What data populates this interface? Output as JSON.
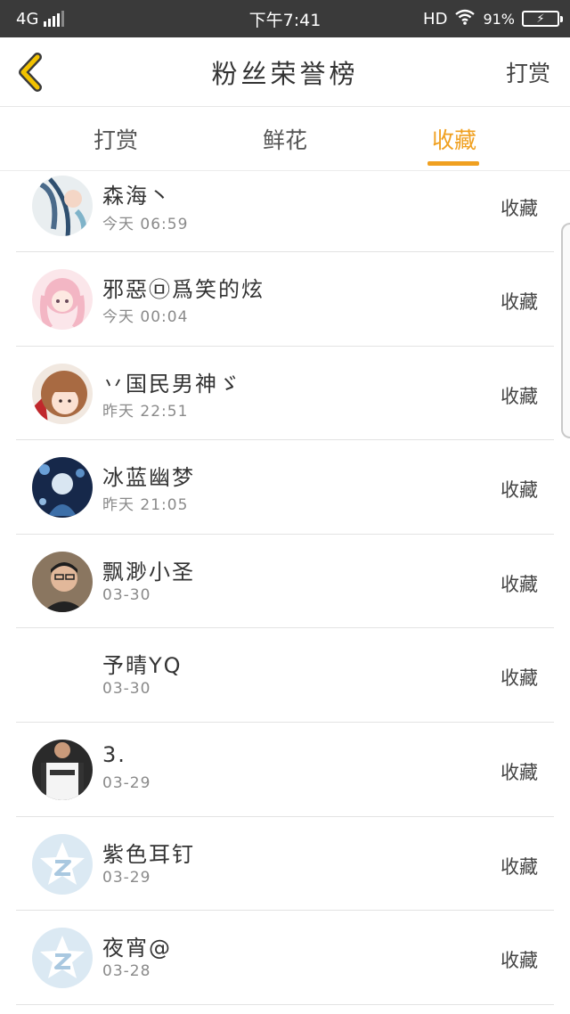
{
  "status_bar": {
    "network": "4G",
    "time": "下午7:41",
    "hd": "HD",
    "battery": "91%"
  },
  "header": {
    "title": "粉丝荣誉榜",
    "action_label": "打赏"
  },
  "tabs": [
    {
      "label": "打赏",
      "active": false
    },
    {
      "label": "鲜花",
      "active": false
    },
    {
      "label": "收藏",
      "active": true
    }
  ],
  "colors": {
    "accent": "#f0a020",
    "status_bar": "#3a3a3a",
    "back_icon": "#f2c200"
  },
  "list": [
    {
      "name": "森海丶",
      "time": "今天 06:59",
      "action": "收藏",
      "avatar": "anime-art-avatar"
    },
    {
      "name": "邪惡㉤爲笑的炫",
      "time": "今天 00:04",
      "action": "收藏",
      "avatar": "pink-anime-avatar"
    },
    {
      "name": "丷国民男神ゞ",
      "time": "昨天 22:51",
      "action": "收藏",
      "avatar": "girl-photo-avatar"
    },
    {
      "name": "冰蓝幽梦",
      "time": "昨天 21:05",
      "action": "收藏",
      "avatar": "dark-art-avatar"
    },
    {
      "name": "飘渺小圣",
      "time": "03-30",
      "action": "收藏",
      "avatar": "man-photo-avatar"
    },
    {
      "name": "予晴YQ",
      "time": "03-30",
      "action": "收藏",
      "avatar": "empty-avatar"
    },
    {
      "name": "3.",
      "time": "03-29",
      "action": "收藏",
      "avatar": "shirt-photo-avatar"
    },
    {
      "name": "紫色耳钉",
      "time": "03-29",
      "action": "收藏",
      "avatar": "qzone-default-avatar"
    },
    {
      "name": "夜宵@",
      "time": "03-28",
      "action": "收藏",
      "avatar": "qzone-default-avatar"
    }
  ]
}
